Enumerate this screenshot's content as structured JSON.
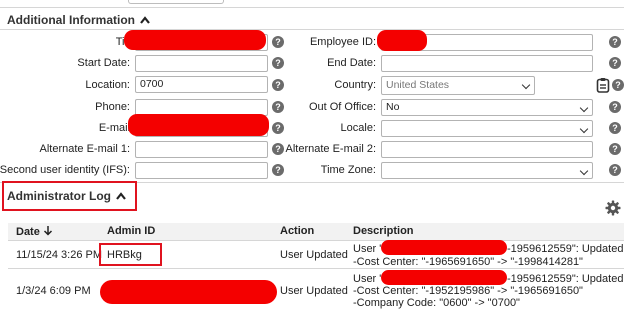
{
  "additional_info": {
    "title": "Additional Information",
    "fields": {
      "title_label": "Titl",
      "employee_id_label": "Employee ID:",
      "start_date_label": "Start Date:",
      "end_date_label": "End Date:",
      "location_label": "Location:",
      "location_value": "0700",
      "country_label": "Country:",
      "country_value": "United States",
      "phone_label": "Phone:",
      "out_of_office_label": "Out Of Office:",
      "out_of_office_value": "No",
      "email_label": "E-mail",
      "locale_label": "Locale:",
      "alt_email1_label": "Alternate E-mail 1:",
      "alt_email2_label": "Alternate E-mail 2:",
      "second_identity_label": "Second user identity (IFS):",
      "time_zone_label": "Time Zone:"
    },
    "help_glyph": "?"
  },
  "admin_log": {
    "title": "Administrator Log",
    "columns": {
      "date": "Date",
      "admin_id": "Admin ID",
      "action": "Action",
      "description": "Description"
    },
    "rows": [
      {
        "date": "11/15/24 3:26 PM",
        "admin_id": "HRBkg",
        "action": "User Updated",
        "desc_line1_prefix": "User \"",
        "desc_line1_suffix": "-1959612559\": Updated.",
        "desc_line2": "-Cost Center: \"-1965691650\" -> \"-1998414281\""
      },
      {
        "date": "1/3/24 6:09 PM",
        "admin_id": "",
        "action": "User Updated",
        "desc_line1_prefix": "User \"",
        "desc_line1_suffix": "-1959612559\": Updated.",
        "desc_line2": "-Cost Center: \"-1952195986\" -> \"-1965691650\"",
        "desc_line3": "-Company Code: \"0600\" -> \"0700\""
      }
    ]
  },
  "colors": {
    "redaction": "#f40000",
    "highlight_border": "#e0131f",
    "help_icon": "#6b6b6b"
  },
  "icons": [
    "caret-up-icon",
    "help-icon",
    "clipboard-icon",
    "gear-icon",
    "sort-down-arrow-icon"
  ]
}
